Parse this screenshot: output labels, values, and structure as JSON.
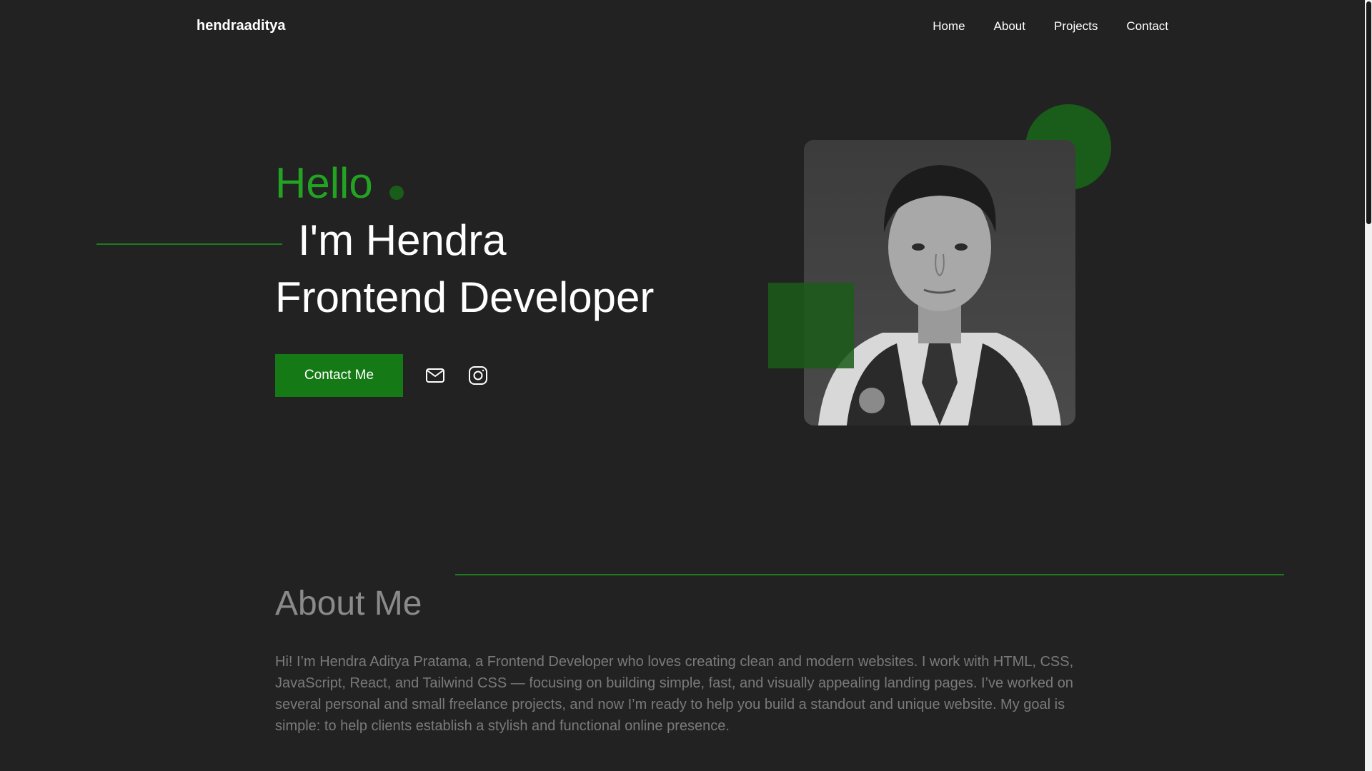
{
  "nav": {
    "logo": "hendraaditya",
    "links": [
      "Home",
      "About",
      "Projects",
      "Contact"
    ]
  },
  "hero": {
    "greeting": "Hello",
    "name": "I'm Hendra",
    "role": "Frontend Developer",
    "cta_label": "Contact Me",
    "social_icons": [
      "mail-icon",
      "instagram-icon"
    ]
  },
  "about": {
    "title": "About Me",
    "text": "Hi! I’m Hendra Aditya Pratama, a Frontend Developer who loves creating clean and modern websites. I work with HTML, CSS, JavaScript, React, and Tailwind CSS — focusing on building simple, fast, and visually appealing landing pages. I’ve worked on several personal and small freelance projects, and now I’m ready to help you build a standout and unique website. My goal is simple: to help clients establish a stylish and functional online presence."
  },
  "colors": {
    "background": "#222222",
    "accent": "#22a322",
    "accent_dark": "#1a5c1a",
    "button": "#157a15"
  }
}
